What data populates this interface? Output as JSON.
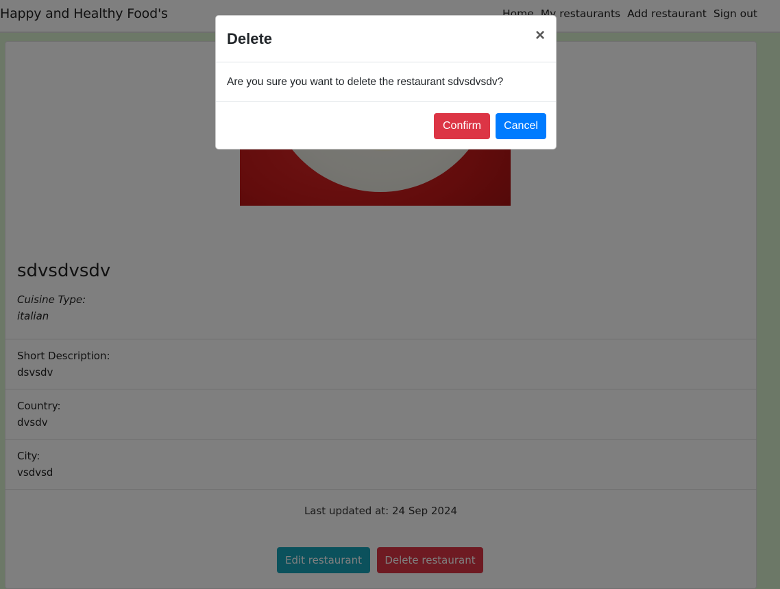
{
  "navbar": {
    "brand": "Happy and Healthy Food's",
    "links": [
      "Home",
      "My restaurants",
      "Add restaurant",
      "Sign out"
    ]
  },
  "restaurant": {
    "name": "sdvsdvsdv",
    "cuisine_label": "Cuisine Type:",
    "cuisine_value": "italian",
    "short_description_label": "Short Description:",
    "short_description_value": "dsvsdv",
    "country_label": "Country:",
    "country_value": "dvsdv",
    "city_label": "City:",
    "city_value": "vsdvsd",
    "last_updated": "Last updated at: 24 Sep 2024",
    "edit_label": "Edit restaurant",
    "delete_label": "Delete restaurant"
  },
  "modal": {
    "title": "Delete",
    "close_glyph": "×",
    "message": "Are you sure you want to delete the restaurant sdvsdvsdv?",
    "confirm_label": "Confirm",
    "cancel_label": "Cancel"
  },
  "colors": {
    "page_background": "#d9f0cf",
    "confirm": "#dc3545",
    "cancel": "#007bff",
    "edit": "#17a2b8",
    "delete": "#dc3545"
  }
}
